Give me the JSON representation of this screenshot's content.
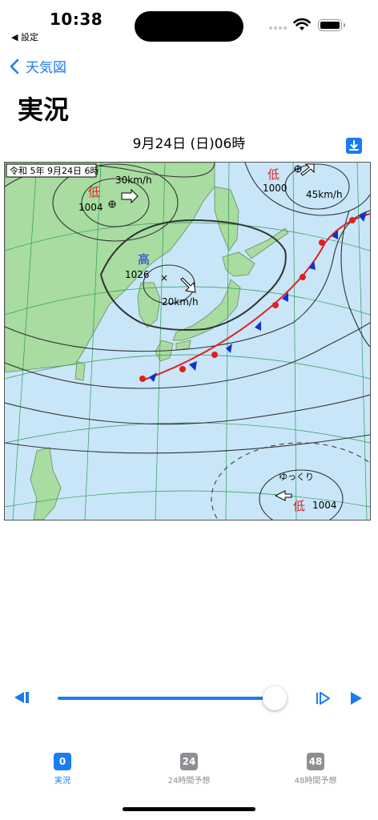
{
  "status_bar": {
    "time": "10:38",
    "back_app": "◀ 設定"
  },
  "nav": {
    "back_label": "天気図",
    "title": "実況"
  },
  "map_header": {
    "date": "9月24日 (日)06時"
  },
  "weather_map": {
    "stamp": "令和 5年 9月24日 6時",
    "low_nw": {
      "symbol": "低",
      "pressure": "1004",
      "speed": "30km/h"
    },
    "low_ne": {
      "symbol": "低",
      "pressure": "1000",
      "speed": "45km/h"
    },
    "high": {
      "symbol": "高",
      "pressure": "1026",
      "speed": "20km/h"
    },
    "low_south": {
      "symbol": "低",
      "pressure": "1004",
      "movement": "ゆっくり"
    }
  },
  "tabs": [
    {
      "badge": "0",
      "label": "実況",
      "active": true
    },
    {
      "badge": "24",
      "label": "24時間予想",
      "active": false
    },
    {
      "badge": "48",
      "label": "48時間予想",
      "active": false
    }
  ],
  "colors": {
    "accent": "#1a7cf0",
    "tab_inactive": "#8e8e93",
    "sea": "#c8e6f7",
    "land": "#a8dca0"
  }
}
